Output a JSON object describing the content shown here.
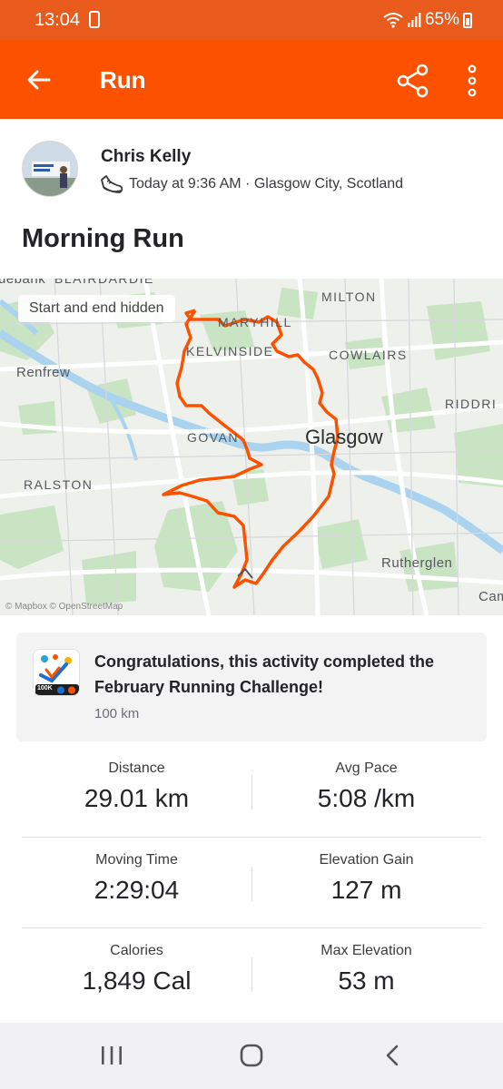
{
  "status_bar": {
    "time": "13:04",
    "battery": "65%"
  },
  "app_bar": {
    "title": "Run"
  },
  "activity": {
    "athlete_name": "Chris Kelly",
    "meta": "Today at 9:36 AM · Glasgow City, Scotland",
    "title": "Morning Run"
  },
  "map": {
    "privacy_pill": "Start and end hidden",
    "attribution": "© Mapbox © OpenStreetMap",
    "labels": {
      "bank": "uebank",
      "blairdardie": "BLAIRDARDIE",
      "milton": "MILTON",
      "maryhill": "MARYHILL",
      "kelvinside": "KELVINSIDE",
      "cowlairs": "COWLAIRS",
      "renfrew": "Renfrew",
      "riddrie": "RIDDRI",
      "govan": "GOVAN",
      "glasgow": "Glasgow",
      "ralston": "RALSTON",
      "rutherglen": "Rutherglen",
      "cam": "Cam"
    },
    "route_color": "#fc5200"
  },
  "challenge": {
    "text": "Congratulations, this activity completed the February Running Challenge!",
    "subtitle": "100 km",
    "badge_label": "100K"
  },
  "stats": {
    "distance": {
      "label": "Distance",
      "value": "29.01 km"
    },
    "avg_pace": {
      "label": "Avg Pace",
      "value": "5:08 /km"
    },
    "moving_time": {
      "label": "Moving Time",
      "value": "2:29:04"
    },
    "elevation_gain": {
      "label": "Elevation Gain",
      "value": "127 m"
    },
    "calories": {
      "label": "Calories",
      "value": "1,849 Cal"
    },
    "max_elevation": {
      "label": "Max Elevation",
      "value": "53 m"
    }
  },
  "nav": {
    "recents_icon": "recents-icon",
    "home_icon": "home-icon",
    "back_icon": "back-icon"
  },
  "colors": {
    "brand_orange": "#fc5200",
    "status_bar": "#e85b1c",
    "card_background": "#f3f3f4"
  }
}
